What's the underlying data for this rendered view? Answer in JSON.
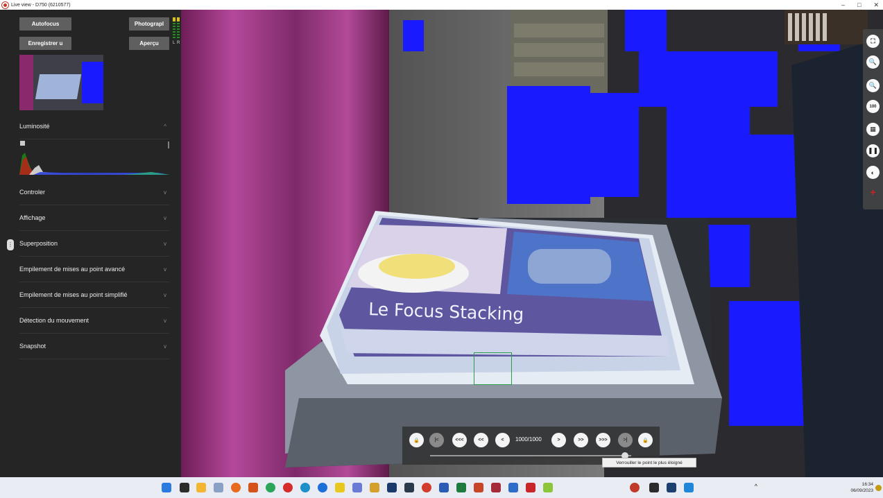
{
  "window": {
    "title": "Live view - D750 (6210577)",
    "controls": [
      "–",
      "□",
      "✕"
    ]
  },
  "left_panel": {
    "buttons": {
      "autofocus": "Autofocus",
      "photograph": "Photograpl",
      "record": "Enregistrer u",
      "preview": "Aperçu"
    },
    "meter_labels": [
      "L",
      "R"
    ],
    "sections": [
      {
        "label": "Luminosité",
        "chevron": "^"
      },
      {
        "label": "Controler",
        "chevron": "v"
      },
      {
        "label": "Affichage",
        "chevron": "v"
      },
      {
        "label": "Superposition",
        "chevron": "v"
      },
      {
        "label": "Empilement de mises au point avancé",
        "chevron": "v"
      },
      {
        "label": "Empilement de mises au point simplifié",
        "chevron": "v"
      },
      {
        "label": "Détection du mouvement",
        "chevron": "v"
      },
      {
        "label": "Snapshot",
        "chevron": "v"
      }
    ]
  },
  "live_view": {
    "photo_text": "Le Focus Stacking"
  },
  "right_toolbar": {
    "zoom_100_label": "100"
  },
  "navigation": {
    "counter": "1000/1000",
    "buttons": [
      "🔒",
      "|<",
      "<<<",
      "<<",
      "<",
      ">",
      ">>",
      ">>>",
      ">|",
      "🔒"
    ],
    "tooltip": "Verrouiller le point le plus éloigné",
    "slider_position": 0.97
  },
  "taskbar": {
    "time": "16:34",
    "date": "06/09/2023",
    "tray_caret": "^"
  },
  "colors": {
    "panel_bg": "#252525",
    "button_bg": "#5f5f5f",
    "accent_blue": "#1a1aff",
    "curtain_magenta": "#a03a8a",
    "focus_green": "#2a9d4a"
  }
}
